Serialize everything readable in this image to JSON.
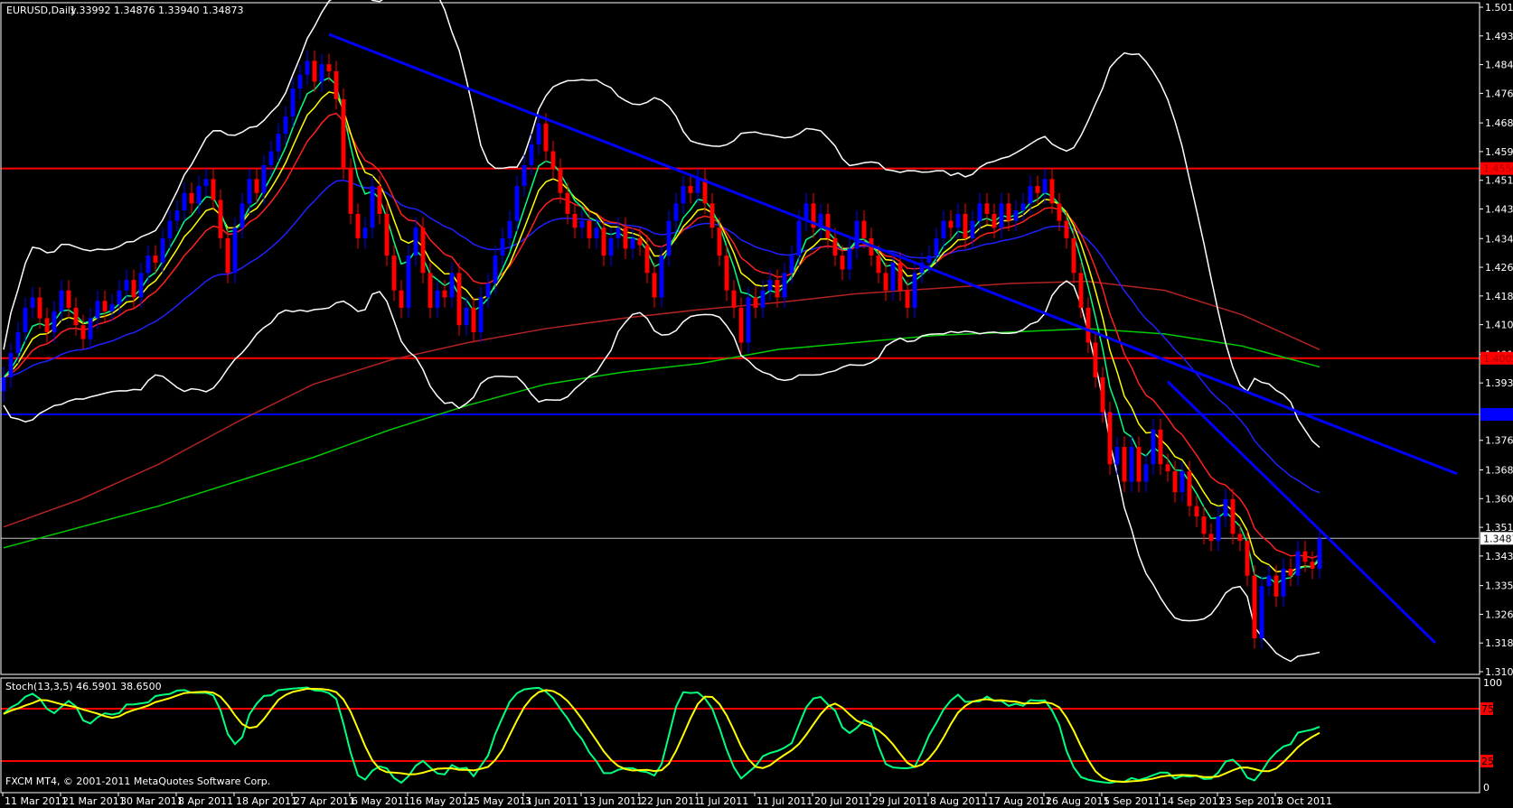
{
  "header": {
    "symbol_period": "EURUSD,Daily",
    "ohlc": "1.33992 1.34876 1.33940 1.34873"
  },
  "stoch_label": "Stoch(13,3,5) 46.5901 38.6500",
  "copyright": "FXCM MT4, © 2001-2011 MetaQuotes Software Corp.",
  "colors": {
    "up": "#0000ff",
    "down": "#ff0000",
    "ema_fast": "#00ff7f",
    "ema_mid": "#ffff00",
    "ema_slow": "#ff2020",
    "ema_long": "#2020ff",
    "bands": "#ffffff",
    "sma_red": "#b22222",
    "sma_green": "#00cc00",
    "stoch_k": "#00ff7f",
    "stoch_d": "#ffff00"
  },
  "chart_data": {
    "type": "candlestick",
    "symbol": "EURUSD",
    "timeframe": "Daily",
    "ylim": [
      1.3104,
      1.5014
    ],
    "price_ticks": [
      "1.50140",
      "1.49315",
      "1.48490",
      "1.47665",
      "1.46815",
      "1.45990",
      "1.45165",
      "1.44340",
      "1.43490",
      "1.42665",
      "1.41840",
      "1.41015",
      "1.40165",
      "1.39340",
      "1.37690",
      "1.36840",
      "1.36015",
      "1.35190",
      "1.34365",
      "1.33515",
      "1.32690",
      "1.31865",
      "1.31040"
    ],
    "date_ticks": [
      "11 Mar 2011",
      "21 Mar 2011",
      "30 Mar 2011",
      "8 Apr 2011",
      "18 Apr 2011",
      "27 Apr 2011",
      "6 May 2011",
      "16 May 2011",
      "25 May 2011",
      "3 Jun 2011",
      "13 Jun 2011",
      "22 Jun 2011",
      "1 Jul 2011",
      "11 Jul 2011",
      "20 Jul 2011",
      "29 Jul 2011",
      "8 Aug 2011",
      "17 Aug 2011",
      "26 Aug 2011",
      "5 Sep 2011",
      "14 Sep 2011",
      "23 Sep 2011",
      "3 Oct 2011"
    ],
    "closes": [
      1.395,
      1.402,
      1.408,
      1.415,
      1.418,
      1.412,
      1.408,
      1.414,
      1.42,
      1.415,
      1.41,
      1.406,
      1.412,
      1.417,
      1.414,
      1.416,
      1.42,
      1.423,
      1.418,
      1.425,
      1.43,
      1.428,
      1.435,
      1.44,
      1.443,
      1.448,
      1.445,
      1.45,
      1.452,
      1.446,
      1.435,
      1.425,
      1.438,
      1.445,
      1.452,
      1.448,
      1.456,
      1.46,
      1.465,
      1.47,
      1.478,
      1.482,
      1.486,
      1.48,
      1.485,
      1.483,
      1.475,
      1.455,
      1.442,
      1.435,
      1.438,
      1.45,
      1.442,
      1.43,
      1.42,
      1.415,
      1.43,
      1.438,
      1.425,
      1.415,
      1.42,
      1.418,
      1.425,
      1.41,
      1.415,
      1.408,
      1.418,
      1.422,
      1.43,
      1.435,
      1.44,
      1.45,
      1.456,
      1.462,
      1.468,
      1.46,
      1.455,
      1.448,
      1.442,
      1.438,
      1.44,
      1.435,
      1.438,
      1.43,
      1.435,
      1.438,
      1.432,
      1.435,
      1.433,
      1.425,
      1.418,
      1.43,
      1.44,
      1.445,
      1.45,
      1.448,
      1.452,
      1.445,
      1.438,
      1.43,
      1.42,
      1.415,
      1.405,
      1.418,
      1.415,
      1.42,
      1.423,
      1.418,
      1.425,
      1.43,
      1.44,
      1.445,
      1.438,
      1.442,
      1.435,
      1.43,
      1.426,
      1.432,
      1.44,
      1.435,
      1.43,
      1.425,
      1.42,
      1.428,
      1.42,
      1.415,
      1.425,
      1.428,
      1.43,
      1.435,
      1.44,
      1.438,
      1.442,
      1.435,
      1.44,
      1.445,
      1.442,
      1.438,
      1.445,
      1.44,
      1.443,
      1.445,
      1.45,
      1.448,
      1.452,
      1.445,
      1.44,
      1.435,
      1.425,
      1.415,
      1.405,
      1.395,
      1.385,
      1.37,
      1.375,
      1.365,
      1.375,
      1.365,
      1.37,
      1.38,
      1.37,
      1.368,
      1.362,
      1.368,
      1.358,
      1.355,
      1.35,
      1.348,
      1.355,
      1.36,
      1.35,
      1.348,
      1.338,
      1.32,
      1.335,
      1.338,
      1.332,
      1.34,
      1.338,
      1.345,
      1.342,
      1.34,
      1.3487
    ],
    "last_ohlc": {
      "open": 1.33992,
      "high": 1.34876,
      "low": 1.3394,
      "close": 1.34873
    },
    "long_sma_red": [
      1.352,
      1.36,
      1.37,
      1.382,
      1.393,
      1.4,
      1.405,
      1.409,
      1.412,
      1.4145,
      1.4165,
      1.419,
      1.4205,
      1.422,
      1.4226,
      1.42,
      1.413,
      1.403
    ],
    "long_sma_green": [
      1.346,
      1.352,
      1.358,
      1.365,
      1.372,
      1.38,
      1.387,
      1.393,
      1.3965,
      1.399,
      1.403,
      1.405,
      1.407,
      1.408,
      1.409,
      1.4075,
      1.404,
      1.398
    ],
    "horizontal_lines": [
      {
        "price": 1.45504,
        "label": "1.45504",
        "color": "#ff0000"
      },
      {
        "price": 1.40051,
        "label": "1.40051",
        "color": "#ff0000"
      },
      {
        "price": 1.38436,
        "label": "1.38436",
        "color": "#0000ff"
      },
      {
        "price": 1.34873,
        "label": "1.34873",
        "color": "#c0c0c0"
      }
    ],
    "trendlines": [
      {
        "from": {
          "date": "29 Apr 2011",
          "price": 1.4936
        },
        "to": {
          "date": "future",
          "price": 1.3673
        }
      },
      {
        "from": {
          "date": "13 Sep 2011",
          "price": 1.3938
        },
        "to": {
          "date": "future",
          "price": 1.3187
        }
      }
    ],
    "stochastic": {
      "params": "13,3,5",
      "k": 46.5901,
      "d": 38.65,
      "levels": [
        "75",
        "25"
      ],
      "scale": [
        "100",
        "0"
      ]
    }
  }
}
